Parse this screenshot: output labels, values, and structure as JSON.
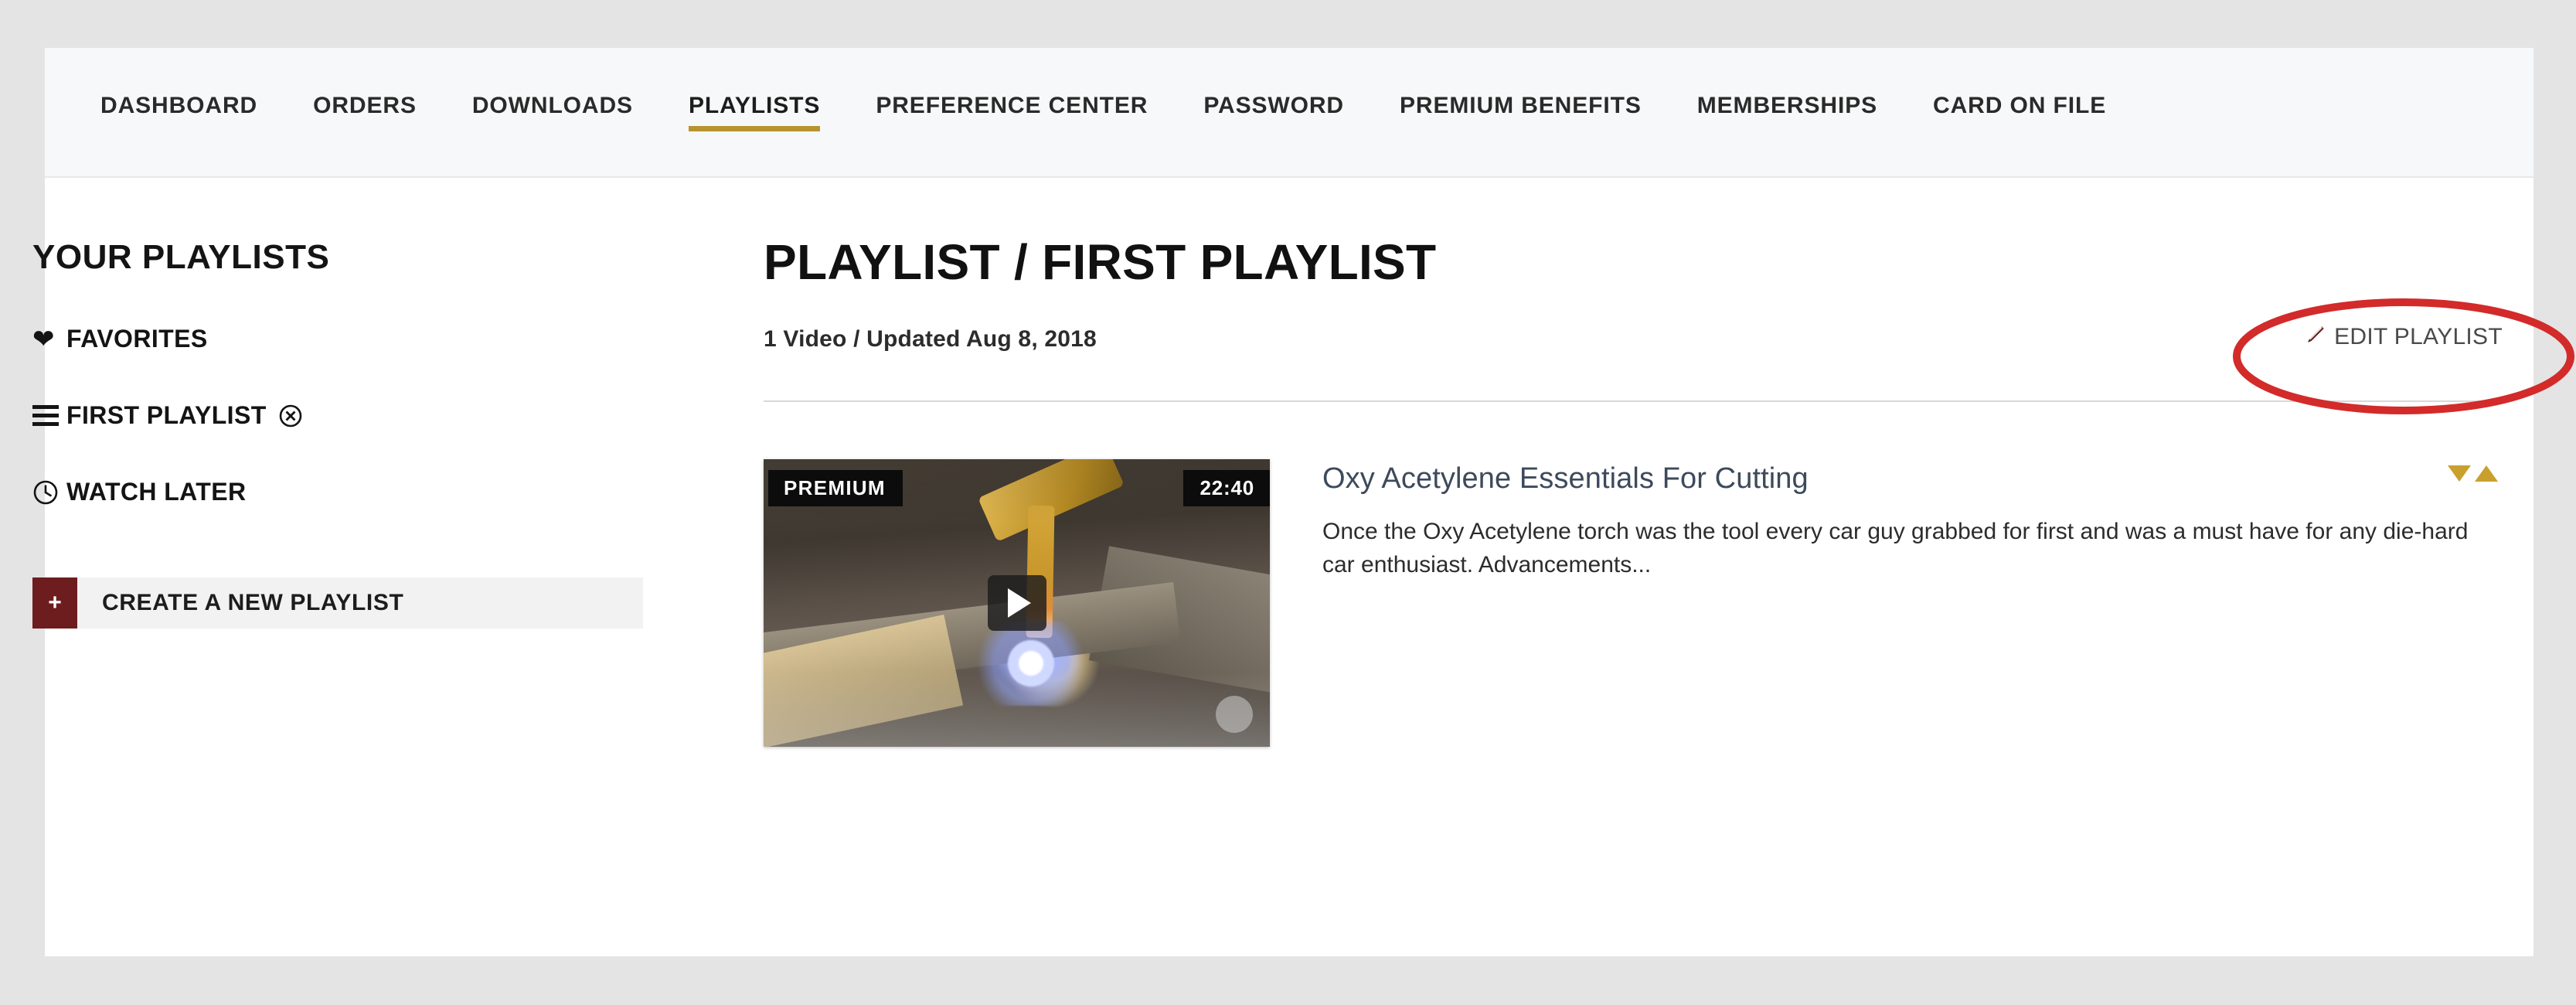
{
  "nav": {
    "items": [
      {
        "label": "DASHBOARD",
        "active": false
      },
      {
        "label": "ORDERS",
        "active": false
      },
      {
        "label": "DOWNLOADS",
        "active": false
      },
      {
        "label": "PLAYLISTS",
        "active": true
      },
      {
        "label": "PREFERENCE CENTER",
        "active": false
      },
      {
        "label": "PASSWORD",
        "active": false
      },
      {
        "label": "PREMIUM BENEFITS",
        "active": false
      },
      {
        "label": "MEMBERSHIPS",
        "active": false
      },
      {
        "label": "CARD ON FILE",
        "active": false
      }
    ]
  },
  "sidebar": {
    "title": "YOUR PLAYLISTS",
    "items": [
      {
        "label": "FAVORITES",
        "icon": "heart-icon",
        "deletable": false
      },
      {
        "label": "FIRST PLAYLIST",
        "icon": "hamburger-icon",
        "deletable": true,
        "delete_glyph": "⊗"
      },
      {
        "label": "WATCH LATER",
        "icon": "clock-icon",
        "deletable": false
      }
    ],
    "create_button": {
      "plus_glyph": "+",
      "label": "CREATE A NEW PLAYLIST"
    }
  },
  "main": {
    "heading": "PLAYLIST / FIRST PLAYLIST",
    "meta": "1 Video / Updated Aug 8, 2018",
    "edit_button": {
      "label": "EDIT PLAYLIST",
      "icon": "pencil-icon"
    },
    "videos": [
      {
        "badge": "PREMIUM",
        "duration": "22:40",
        "title": "Oxy Acetylene Essentials For Cutting",
        "description": "Once the Oxy Acetylene torch was the tool every car guy grabbed for first and was a must have for any die-hard car enthusiast. Advancements...",
        "thumbnail_alt": "oxy-acetylene-cutting-torch-thumbnail",
        "play_icon": "play-icon"
      }
    ],
    "sort_controls": {
      "move_down_icon": "triangle-down-icon",
      "move_up_icon": "triangle-up-icon"
    }
  },
  "annotation": {
    "shape": "ellipse",
    "target": "edit-playlist-button",
    "color": "#d32a2a"
  },
  "colors": {
    "page_background": "#e4e4e4",
    "card_background": "#ffffff",
    "nav_background": "#f7f8f9",
    "accent_gold": "#b8932f",
    "accent_dark_red": "#6d1d1d",
    "annotation_red": "#d32a2a",
    "link_blue_gray": "#3d4a5c",
    "sort_triangle_gold": "#c9a02e"
  }
}
